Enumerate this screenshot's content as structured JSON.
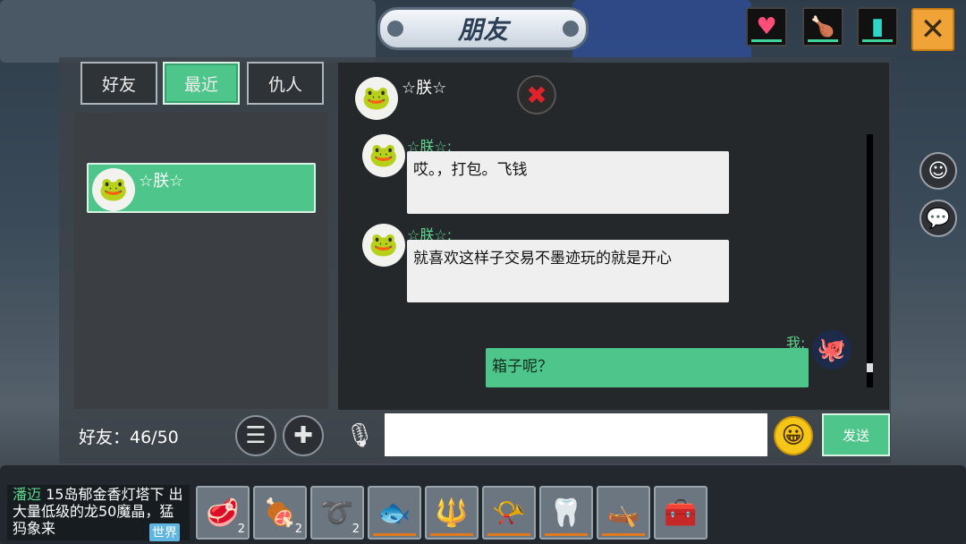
{
  "header": {
    "title": "朋友"
  },
  "status_icons": [
    {
      "icon": "heart-icon",
      "glyph": "♥",
      "color": "#ff4d7a"
    },
    {
      "icon": "food-icon",
      "glyph": "🍗",
      "color": "#f0d030"
    },
    {
      "icon": "water-icon",
      "glyph": "▮",
      "color": "#2fd6c6"
    }
  ],
  "close": {
    "glyph": "✕"
  },
  "tabs": [
    {
      "label": "好友",
      "active": false
    },
    {
      "label": "最近",
      "active": true
    },
    {
      "label": "仇人",
      "active": false
    }
  ],
  "friends": [
    {
      "name": "☆朕☆",
      "avatar": "frog-avatar-icon"
    }
  ],
  "friend_count": "好友：46/50",
  "chat": {
    "partner_name": "☆朕☆",
    "messages": [
      {
        "sender": "☆朕☆:",
        "text": "哎。，打包。飞钱",
        "mine": false
      },
      {
        "sender": "☆朕☆:",
        "text": "就喜欢这样子交易不墨迹玩的就是开心",
        "mine": false
      },
      {
        "sender": "我:",
        "text": "箱子呢？",
        "mine": true
      }
    ]
  },
  "input": {
    "value": "",
    "send_label": "发送"
  },
  "world_chat": {
    "sender": "潘迈",
    "text": " 15岛郁金香灯塔下  出大量低级的龙50魔晶，猛犸象来",
    "tag": "世界"
  },
  "hotbar": [
    {
      "icon": "meat-icon",
      "glyph": "🥩",
      "count": "2"
    },
    {
      "icon": "steak-icon",
      "glyph": "🍖",
      "count": "2"
    },
    {
      "icon": "rope-icon",
      "glyph": "➰",
      "count": "2"
    },
    {
      "icon": "fish-icon",
      "glyph": "🐟",
      "count": ""
    },
    {
      "icon": "spear-icon",
      "glyph": "🔱",
      "count": ""
    },
    {
      "icon": "horn-icon",
      "glyph": "📯",
      "count": ""
    },
    {
      "icon": "tusk-icon",
      "glyph": "🦷",
      "count": ""
    },
    {
      "icon": "boat-icon",
      "glyph": "🛶",
      "count": ""
    },
    {
      "icon": "chest-icon",
      "glyph": "🧰",
      "count": ""
    }
  ]
}
